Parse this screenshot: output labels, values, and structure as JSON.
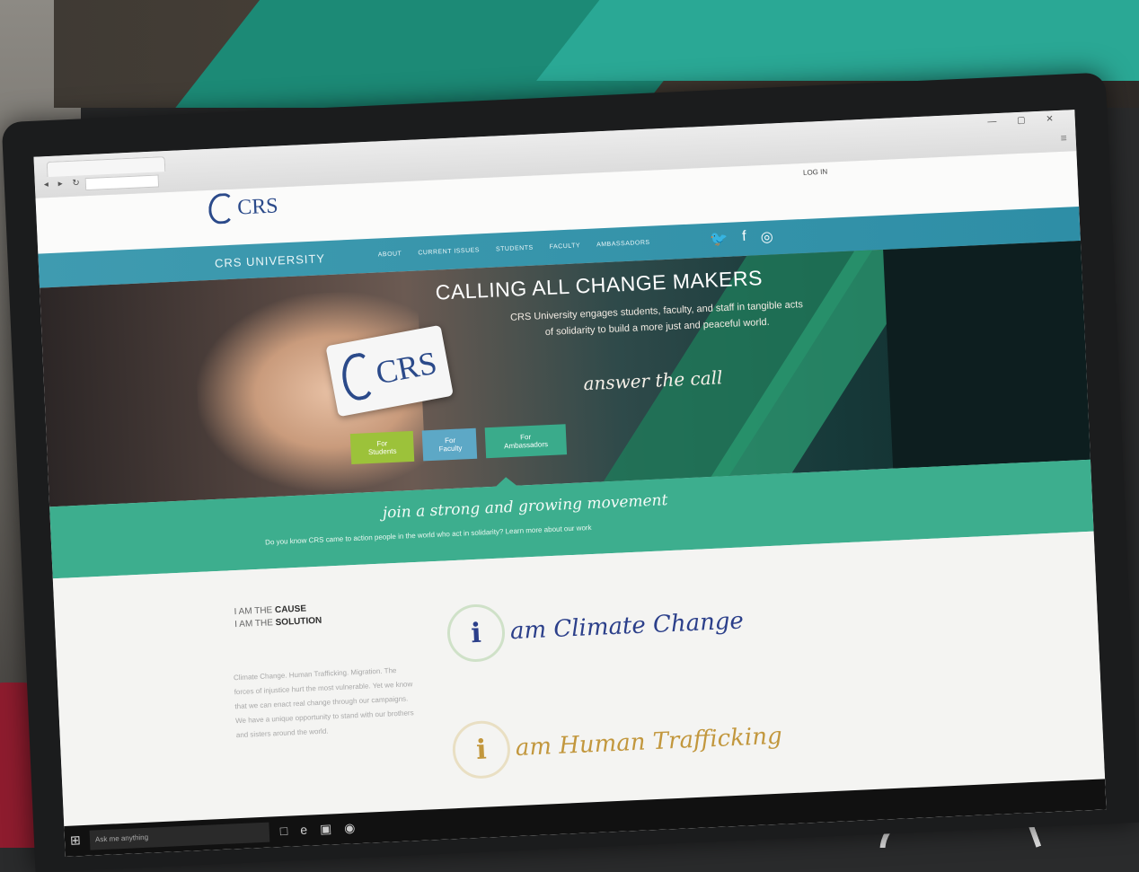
{
  "browser": {
    "nav_glyphs": "◂ ▸ ↻",
    "window_controls": "— ▢ ✕",
    "menu_glyph": "≡"
  },
  "site": {
    "logo_text": "CRS",
    "login_label": "LOG IN",
    "brand": "CRS UNIVERSITY",
    "menu_items": [
      "About",
      "Current Issues",
      "Students",
      "Faculty",
      "Ambassadors"
    ],
    "social_icons": [
      "twitter-icon",
      "facebook-icon",
      "instagram-icon"
    ],
    "social_glyphs": [
      "🐦",
      "f",
      "◎"
    ]
  },
  "hero": {
    "title": "CALLING ALL CHANGE MAKERS",
    "subtitle": "CRS University engages students, faculty, and staff in tangible acts of solidarity to build a more just and peaceful world.",
    "call": "answer the call",
    "card_logo": "CRS",
    "buttons": [
      "For Students",
      "For Faculty",
      "For Ambassadors"
    ]
  },
  "band": {
    "title": "join a strong and growing movement",
    "subtitle": "Do you know CRS came to action people in the world who act in solidarity? Learn more about our work"
  },
  "lower": {
    "cause_line1_prefix": "I AM THE ",
    "cause_line1_bold": "CAUSE",
    "cause_line2_prefix": "I AM THE ",
    "cause_line2_bold": "SOLUTION",
    "body": "Climate Change. Human Trafficking. Migration. The forces of injustice hurt the most vulnerable. Yet we know that we can enact real change through our campaigns. We have a unique opportunity to stand with our brothers and sisters around the world.",
    "campaigns": [
      {
        "initial": "i",
        "name": "am Climate Change",
        "color": "#2b3f8a"
      },
      {
        "initial": "i",
        "name": "am Human Trafficking",
        "color": "#c2973d"
      }
    ]
  },
  "taskbar": {
    "start_glyph": "⊞",
    "search_placeholder": "Ask me anything",
    "icons": [
      "□",
      "e",
      "▣",
      "◉"
    ]
  }
}
